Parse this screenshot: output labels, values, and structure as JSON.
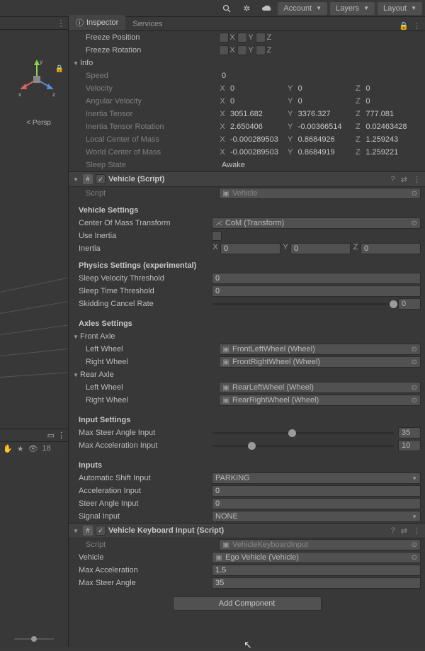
{
  "topbar": {
    "account": "Account",
    "layers": "Layers",
    "layout": "Layout"
  },
  "tabs": {
    "inspector": "Inspector",
    "services": "Services"
  },
  "scene": {
    "persp": "< Persp",
    "visibility": "18"
  },
  "gizmo_axes": {
    "x": "x",
    "y": "y",
    "z": "z"
  },
  "constraints": {
    "freeze_position": {
      "label": "Freeze Position",
      "x": "X",
      "y": "Y",
      "z": "Z"
    },
    "freeze_rotation": {
      "label": "Freeze Rotation",
      "x": "X",
      "y": "Y",
      "z": "Z"
    }
  },
  "info": {
    "label": "Info",
    "speed": {
      "label": "Speed",
      "value": "0"
    },
    "velocity": {
      "label": "Velocity",
      "x": "0",
      "y": "0",
      "z": "0"
    },
    "angular_velocity": {
      "label": "Angular Velocity",
      "x": "0",
      "y": "0",
      "z": "0"
    },
    "inertia_tensor": {
      "label": "Inertia Tensor",
      "x": "3051.682",
      "y": "3376.327",
      "z": "777.081"
    },
    "inertia_tensor_rot": {
      "label": "Inertia Tensor Rotation",
      "x": "2.650406",
      "y": "-0.00366514",
      "z": "0.02463428"
    },
    "local_com": {
      "label": "Local Center of Mass",
      "x": "-0.000289503",
      "y": "0.8684926",
      "z": "1.259243"
    },
    "world_com": {
      "label": "World Center of Mass",
      "x": "-0.000289503",
      "y": "0.8684919",
      "z": "1.259221"
    },
    "sleep_state": {
      "label": "Sleep State",
      "value": "Awake"
    }
  },
  "vehicle": {
    "header": "Vehicle (Script)",
    "script": {
      "label": "Script",
      "value": "Vehicle"
    },
    "settings_label": "Vehicle Settings",
    "com": {
      "label": "Center Of Mass Transform",
      "value": "CoM (Transform)"
    },
    "use_inertia": "Use Inertia",
    "inertia": {
      "label": "Inertia",
      "x": "0",
      "y": "0",
      "z": "0"
    },
    "physics_label": "Physics Settings (experimental)",
    "sleep_vel": {
      "label": "Sleep Velocity Threshold",
      "value": "0"
    },
    "sleep_time": {
      "label": "Sleep Time Threshold",
      "value": "0"
    },
    "skidding": {
      "label": "Skidding Cancel Rate",
      "value": "0"
    },
    "axles_label": "Axles Settings",
    "front_axle": "Front Axle",
    "rear_axle": "Rear Axle",
    "left_wheel": "Left Wheel",
    "right_wheel": "Right Wheel",
    "fl": "FrontLeftWheel (Wheel)",
    "fr": "FrontRightWheel (Wheel)",
    "rl": "RearLeftWheel (Wheel)",
    "rr": "RearRightWheel (Wheel)",
    "input_settings": "Input Settings",
    "max_steer": {
      "label": "Max Steer Angle Input",
      "value": "35"
    },
    "max_accel": {
      "label": "Max Acceleration Input",
      "value": "10"
    },
    "inputs_label": "Inputs",
    "auto_shift": {
      "label": "Automatic Shift Input",
      "value": "PARKING"
    },
    "accel_input": {
      "label": "Acceleration Input",
      "value": "0"
    },
    "steer_input": {
      "label": "Steer Angle Input",
      "value": "0"
    },
    "signal_input": {
      "label": "Signal Input",
      "value": "NONE"
    }
  },
  "keyboard": {
    "header": "Vehicle Keyboard Input (Script)",
    "script": {
      "label": "Script",
      "value": "VehicleKeyboardInput"
    },
    "vehicle": {
      "label": "Vehicle",
      "value": "Ego Vehicle (Vehicle)"
    },
    "max_accel": {
      "label": "Max Acceleration",
      "value": "1.5"
    },
    "max_steer": {
      "label": "Max Steer Angle",
      "value": "35"
    }
  },
  "add_component": "Add Component",
  "axis_labels": {
    "x": "X",
    "y": "Y",
    "z": "Z"
  },
  "icons": {
    "search": "search-icon",
    "light": "light-icon",
    "cloud": "cloud-icon"
  }
}
